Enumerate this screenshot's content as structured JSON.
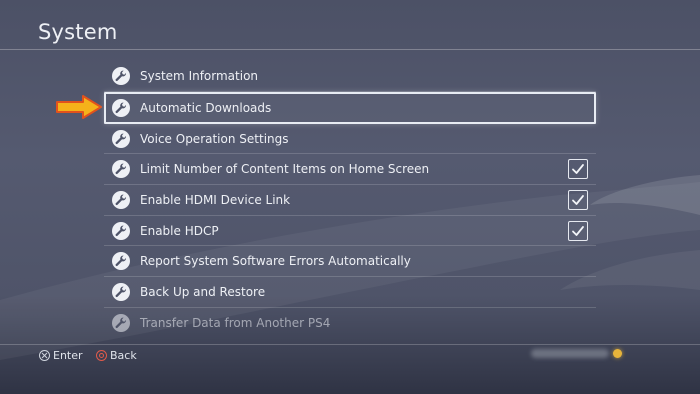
{
  "header": {
    "title": "System"
  },
  "menu": {
    "items": [
      {
        "label": "System Information",
        "checked": null,
        "selected": false,
        "faded": false
      },
      {
        "label": "Automatic Downloads",
        "checked": null,
        "selected": true,
        "faded": false
      },
      {
        "label": "Voice Operation Settings",
        "checked": null,
        "selected": false,
        "faded": false
      },
      {
        "label": "Limit Number of Content Items on Home Screen",
        "checked": true,
        "selected": false,
        "faded": false
      },
      {
        "label": "Enable HDMI Device Link",
        "checked": true,
        "selected": false,
        "faded": false
      },
      {
        "label": "Enable HDCP",
        "checked": true,
        "selected": false,
        "faded": false
      },
      {
        "label": "Report System Software Errors Automatically",
        "checked": null,
        "selected": false,
        "faded": false
      },
      {
        "label": "Back Up and Restore",
        "checked": null,
        "selected": false,
        "faded": false
      },
      {
        "label": "Transfer Data from Another PS4",
        "checked": null,
        "selected": false,
        "faded": true
      }
    ]
  },
  "footer": {
    "enter_label": "Enter",
    "back_label": "Back"
  },
  "colors": {
    "arrow_fill": "#f5b21a",
    "arrow_stroke": "#e2521c",
    "circle_button": "#e05a4a",
    "status_dot": "#e7b43b"
  },
  "icons": {
    "item_icon": "wrench-icon",
    "check_icon": "checkmark-icon",
    "enter_button_icon": "cross-button-icon",
    "back_button_icon": "circle-button-icon"
  }
}
